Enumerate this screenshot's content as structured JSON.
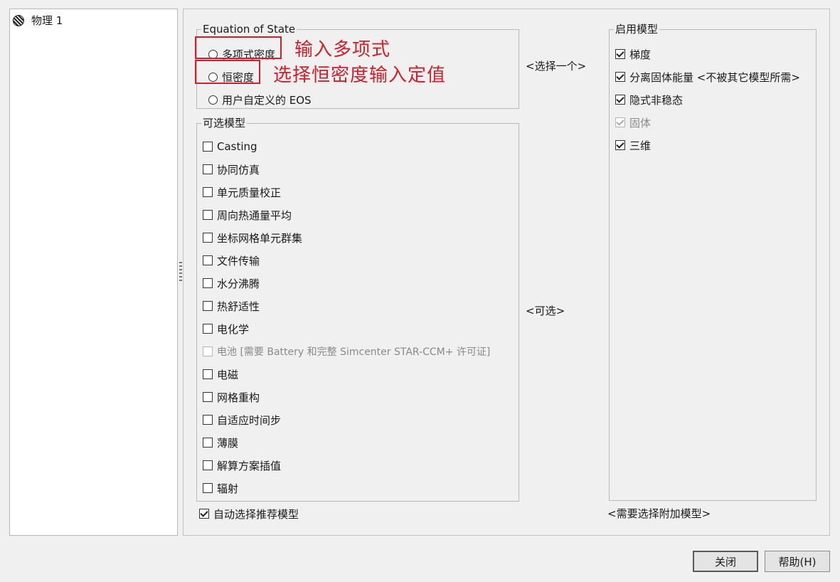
{
  "tree": {
    "node_label": "物理 1"
  },
  "eos": {
    "legend": "Equation of State",
    "options": [
      "多项式密度",
      "恒密度",
      "用户自定义的 EOS"
    ]
  },
  "annotations": {
    "polynomial": "输入多项式",
    "constant": "选择恒密度输入定值"
  },
  "optional": {
    "legend": "可选模型",
    "items": [
      "Casting",
      "协同仿真",
      "单元质量校正",
      "周向热通量平均",
      "坐标网格单元群集",
      "文件传输",
      "水分沸腾",
      "热舒适性",
      "电化学",
      "电池 [需要 Battery 和完整 Simcenter STAR-CCM+ 许可证]",
      "电磁",
      "网格重构",
      "自适应时间步",
      "薄膜",
      "解算方案插值",
      "辐射"
    ]
  },
  "auto_select": "自动选择推荐模型",
  "middle": {
    "select_one": "<选择一个>",
    "optional_hint": "<可选>"
  },
  "enabled": {
    "legend": "启用模型",
    "items": [
      "梯度",
      "分离固体能量  <不被其它模型所需>",
      "隐式非稳态",
      "固体",
      "三维"
    ],
    "footer": "<需要选择附加模型>"
  },
  "buttons": {
    "close": "关闭",
    "help": "帮助(H)"
  },
  "colors": {
    "annotation": "#d0202a",
    "background": "#f0f0f0"
  }
}
